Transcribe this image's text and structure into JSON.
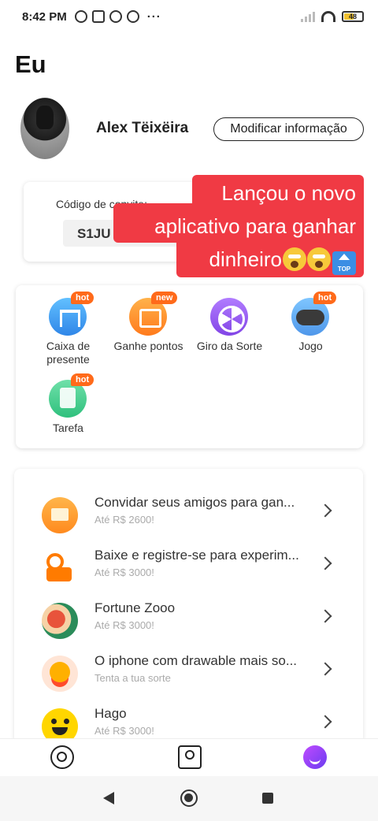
{
  "status_bar": {
    "time": "8:42 PM",
    "dots": "···",
    "battery": "48",
    "icons": [
      "alarm-icon",
      "gallery-icon",
      "whatsapp-icon",
      "music-icon",
      "signal-icon",
      "wifi-icon",
      "battery-icon"
    ]
  },
  "page": {
    "title": "Eu"
  },
  "profile": {
    "name": "Alex Tëixëira",
    "edit_label": "Modificar informação"
  },
  "invite": {
    "label": "Código de convite:",
    "code": "S1JU"
  },
  "banner": {
    "line1": "Lançou o novo",
    "line2": "aplicativo para ganhar",
    "line3": "dinheiro",
    "top_label": "TOP"
  },
  "features": [
    {
      "label": "Caixa de presente",
      "badge": "hot",
      "icon": "gift-icon"
    },
    {
      "label": "Ganhe pontos",
      "badge": "new",
      "icon": "video-icon"
    },
    {
      "label": "Giro da Sorte",
      "badge": "",
      "icon": "wheel-icon"
    },
    {
      "label": "Jogo",
      "badge": "hot",
      "icon": "gamepad-icon"
    },
    {
      "label": "Tarefa",
      "badge": "hot",
      "icon": "task-icon"
    }
  ],
  "list": [
    {
      "title": "Convidar seus amigos para gan...",
      "subtitle": "Até R$ 2600!",
      "icon": "invite-envelope-icon"
    },
    {
      "title": "Baixe e registre-se para experim...",
      "subtitle": "Até R$ 3000!",
      "icon": "kwai-icon"
    },
    {
      "title": "Fortune Zooo",
      "subtitle": "Até R$ 3000!",
      "icon": "fortune-zooo-icon"
    },
    {
      "title": "O iphone com drawable mais so...",
      "subtitle": "Tenta a tua sorte",
      "icon": "coin-icon"
    },
    {
      "title": "Hago",
      "subtitle": "Até R$ 3000!",
      "icon": "hago-icon"
    }
  ],
  "tabbar": {
    "icons": [
      "home-tab-icon",
      "contacts-tab-icon",
      "me-tab-icon"
    ]
  },
  "colors": {
    "banner": "#f03a44",
    "badge": "#ff6a1a",
    "accent": "#8245e6"
  }
}
